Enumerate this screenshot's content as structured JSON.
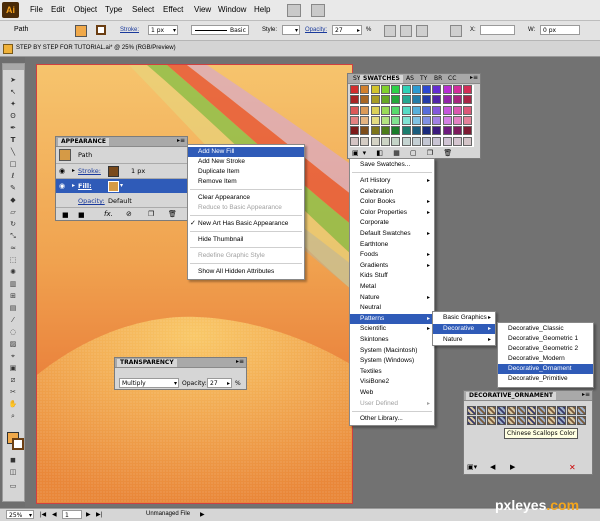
{
  "app": {
    "logo": "Ai"
  },
  "menubar": {
    "items": [
      "File",
      "Edit",
      "Object",
      "Type",
      "Select",
      "Effect",
      "View",
      "Window",
      "Help"
    ]
  },
  "control": {
    "selection": "Path",
    "stroke_label": "Stroke:",
    "stroke_value": "1 px",
    "brush_value": "Basic",
    "style_label": "Style:",
    "opacity_label": "Opacity:",
    "opacity_value": "27",
    "opacity_unit": "%",
    "w_value": "0 px"
  },
  "document": {
    "tab_title": "STEP BY STEP FOR TUTORIAL.ai* @ 25% (RGB/Preview)"
  },
  "status": {
    "zoom": "25%",
    "page": "1",
    "info": "Unmanaged File"
  },
  "appearance": {
    "title": "APPEARANCE",
    "object": "Path",
    "stroke_label": "Stroke:",
    "stroke_value": "1 px",
    "fill_label": "Fill:",
    "opacity_label": "Opacity:",
    "opacity_value": "Default",
    "fx": "fx."
  },
  "appearance_menu": {
    "items": [
      {
        "label": "Add New Fill",
        "state": "highlight"
      },
      {
        "label": "Add New Stroke",
        "state": "normal"
      },
      {
        "label": "Duplicate Item",
        "state": "normal"
      },
      {
        "label": "Remove Item",
        "state": "normal"
      },
      {
        "label": "Clear Appearance",
        "state": "normal"
      },
      {
        "label": "Reduce to Basic Appearance",
        "state": "disabled"
      },
      {
        "label": "New Art Has Basic Appearance",
        "state": "checked"
      },
      {
        "label": "Hide Thumbnail",
        "state": "normal"
      },
      {
        "label": "Redefine Graphic Style",
        "state": "disabled"
      },
      {
        "label": "Show All Hidden Attributes",
        "state": "normal"
      }
    ]
  },
  "swatches": {
    "title": "SWATCHES",
    "tabs": [
      "SY",
      "AS",
      "TY",
      "BR",
      "CC"
    ]
  },
  "swatch_menu": {
    "save": "Save Swatches...",
    "items": [
      {
        "label": "Art History",
        "sub": true
      },
      {
        "label": "Celebration",
        "sub": false
      },
      {
        "label": "Color Books",
        "sub": true
      },
      {
        "label": "Color Properties",
        "sub": true
      },
      {
        "label": "Corporate",
        "sub": false
      },
      {
        "label": "Default Swatches",
        "sub": true
      },
      {
        "label": "Earthtone",
        "sub": false
      },
      {
        "label": "Foods",
        "sub": true
      },
      {
        "label": "Gradients",
        "sub": true
      },
      {
        "label": "Kids Stuff",
        "sub": false
      },
      {
        "label": "Metal",
        "sub": false
      },
      {
        "label": "Nature",
        "sub": true
      },
      {
        "label": "Neutral",
        "sub": false
      },
      {
        "label": "Patterns",
        "sub": true,
        "highlight": true
      },
      {
        "label": "Scientific",
        "sub": true
      },
      {
        "label": "Skintones",
        "sub": false
      },
      {
        "label": "System (Macintosh)",
        "sub": false
      },
      {
        "label": "System (Windows)",
        "sub": false
      },
      {
        "label": "Textiles",
        "sub": false
      },
      {
        "label": "VisiBone2",
        "sub": false
      },
      {
        "label": "Web",
        "sub": false
      },
      {
        "label": "User Defined",
        "sub": true,
        "disabled": true
      }
    ],
    "other": "Other Library..."
  },
  "patterns_menu": {
    "items": [
      {
        "label": "Basic Graphics",
        "highlight": false
      },
      {
        "label": "Decorative",
        "highlight": true
      },
      {
        "label": "Nature",
        "highlight": false
      }
    ]
  },
  "decorative_menu": {
    "items": [
      {
        "label": "Decorative_Classic",
        "highlight": false
      },
      {
        "label": "Decorative_Geometric 1",
        "highlight": false
      },
      {
        "label": "Decorative_Geometric 2",
        "highlight": false
      },
      {
        "label": "Decorative_Modern",
        "highlight": false
      },
      {
        "label": "Decorative_Ornament",
        "highlight": true
      },
      {
        "label": "Decorative_Primitive",
        "highlight": false
      }
    ]
  },
  "ornament_panel": {
    "title": "DECORATIVE_ORNAMENT",
    "tooltip": "Chinese Scallops Color"
  },
  "transparency": {
    "title": "TRANSPARENCY",
    "mode": "Multiply",
    "opacity_label": "Opacity:",
    "opacity_value": "27",
    "unit": "%"
  },
  "watermark": {
    "main": "pxleyes",
    "suffix": ".com"
  }
}
